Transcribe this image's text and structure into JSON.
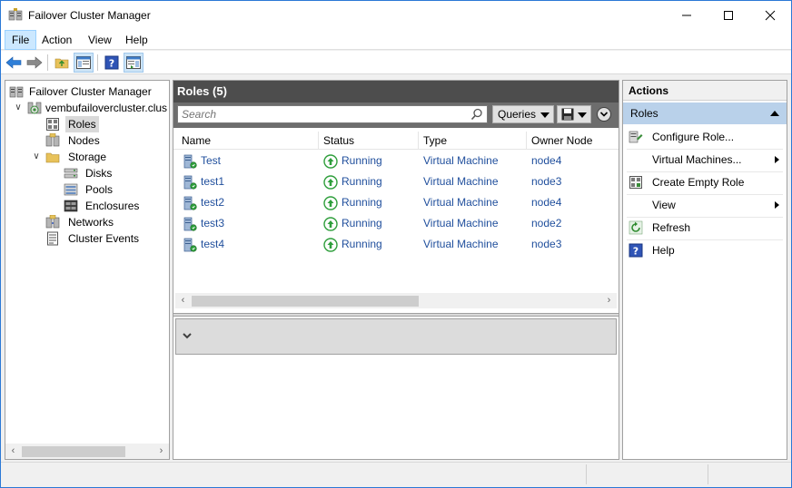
{
  "window": {
    "title": "Failover Cluster Manager"
  },
  "menu": {
    "items": [
      "File",
      "Action",
      "View",
      "Help"
    ],
    "active": "File"
  },
  "toolbar": {
    "buttons": [
      "back-icon",
      "forward-icon",
      "up-folder-icon",
      "show-hide-console-tree-icon",
      "help-icon",
      "show-hide-action-pane-icon"
    ]
  },
  "tree": {
    "root": "Failover Cluster Manager",
    "cluster": "vembufailovercluster.clus",
    "roles": "Roles",
    "nodes": "Nodes",
    "storage": "Storage",
    "disks": "Disks",
    "pools": "Pools",
    "enclosures": "Enclosures",
    "networks": "Networks",
    "cluster_events": "Cluster Events",
    "selected": "Roles"
  },
  "center": {
    "header": "Roles (5)",
    "search_placeholder": "Search",
    "queries_label": "Queries",
    "columns": [
      "Name",
      "Status",
      "Type",
      "Owner Node"
    ],
    "rows": [
      {
        "name": "Test",
        "status": "Running",
        "type": "Virtual Machine",
        "owner": "node4"
      },
      {
        "name": "test1",
        "status": "Running",
        "type": "Virtual Machine",
        "owner": "node3"
      },
      {
        "name": "test2",
        "status": "Running",
        "type": "Virtual Machine",
        "owner": "node4"
      },
      {
        "name": "test3",
        "status": "Running",
        "type": "Virtual Machine",
        "owner": "node2"
      },
      {
        "name": "test4",
        "status": "Running",
        "type": "Virtual Machine",
        "owner": "node3"
      }
    ]
  },
  "actions": {
    "title": "Actions",
    "section": "Roles",
    "items": [
      {
        "label": "Configure Role...",
        "icon": "configure-role-icon",
        "submenu": false
      },
      {
        "label": "Virtual Machines...",
        "icon": "",
        "submenu": true
      },
      {
        "label": "Create Empty Role",
        "icon": "create-empty-role-icon",
        "submenu": false
      },
      {
        "label": "View",
        "icon": "",
        "submenu": true
      },
      {
        "label": "Refresh",
        "icon": "refresh-icon",
        "submenu": false
      },
      {
        "label": "Help",
        "icon": "help-icon",
        "submenu": false
      }
    ]
  },
  "colors": {
    "accent": "#2b79d6",
    "section_header": "#b9d1ea",
    "pane_header": "#4d4d4d",
    "link": "#1f4e9c",
    "running": "#2e9e3b"
  }
}
